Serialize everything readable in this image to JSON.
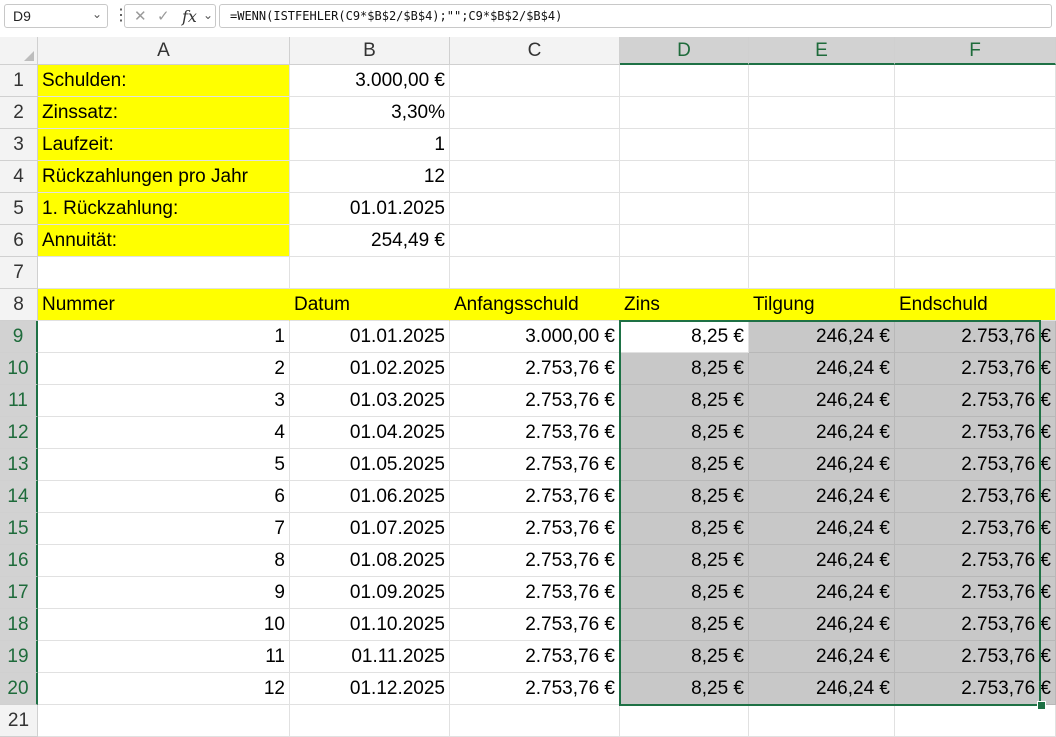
{
  "name_box": "D9",
  "formula": "=WENN(ISTFEHLER(C9*$B$2/$B$4);\"\";C9*$B$2/$B$4)",
  "columns": [
    "A",
    "B",
    "C",
    "D",
    "E",
    "F"
  ],
  "rows": [
    "1",
    "2",
    "3",
    "4",
    "5",
    "6",
    "7",
    "8",
    "9",
    "10",
    "11",
    "12",
    "13",
    "14",
    "15",
    "16",
    "17",
    "18",
    "19",
    "20",
    "21"
  ],
  "params": [
    {
      "label": "Schulden:",
      "value": "3.000,00 €"
    },
    {
      "label": "Zinssatz:",
      "value": "3,30%"
    },
    {
      "label": "Laufzeit:",
      "value": "1"
    },
    {
      "label": "Rückzahlungen pro Jahr",
      "value": "12"
    },
    {
      "label": "1. Rückzahlung:",
      "value": "01.01.2025"
    },
    {
      "label": "Annuität:",
      "value": "254,49 €"
    }
  ],
  "table_headers": [
    "Nummer",
    "Datum",
    "Anfangsschuld",
    "Zins",
    "Tilgung",
    "Endschuld"
  ],
  "table_rows": [
    [
      "1",
      "01.01.2025",
      "3.000,00 €",
      "8,25 €",
      "246,24 €",
      "2.753,76 €"
    ],
    [
      "2",
      "01.02.2025",
      "2.753,76 €",
      "8,25 €",
      "246,24 €",
      "2.753,76 €"
    ],
    [
      "3",
      "01.03.2025",
      "2.753,76 €",
      "8,25 €",
      "246,24 €",
      "2.753,76 €"
    ],
    [
      "4",
      "01.04.2025",
      "2.753,76 €",
      "8,25 €",
      "246,24 €",
      "2.753,76 €"
    ],
    [
      "5",
      "01.05.2025",
      "2.753,76 €",
      "8,25 €",
      "246,24 €",
      "2.753,76 €"
    ],
    [
      "6",
      "01.06.2025",
      "2.753,76 €",
      "8,25 €",
      "246,24 €",
      "2.753,76 €"
    ],
    [
      "7",
      "01.07.2025",
      "2.753,76 €",
      "8,25 €",
      "246,24 €",
      "2.753,76 €"
    ],
    [
      "8",
      "01.08.2025",
      "2.753,76 €",
      "8,25 €",
      "246,24 €",
      "2.753,76 €"
    ],
    [
      "9",
      "01.09.2025",
      "2.753,76 €",
      "8,25 €",
      "246,24 €",
      "2.753,76 €"
    ],
    [
      "10",
      "01.10.2025",
      "2.753,76 €",
      "8,25 €",
      "246,24 €",
      "2.753,76 €"
    ],
    [
      "11",
      "01.11.2025",
      "2.753,76 €",
      "8,25 €",
      "246,24 €",
      "2.753,76 €"
    ],
    [
      "12",
      "01.12.2025",
      "2.753,76 €",
      "8,25 €",
      "246,24 €",
      "2.753,76 €"
    ]
  ],
  "colors": {
    "highlight": "#ffff00",
    "selection": "#1e7145",
    "selected_fill": "#c8c8c8"
  }
}
